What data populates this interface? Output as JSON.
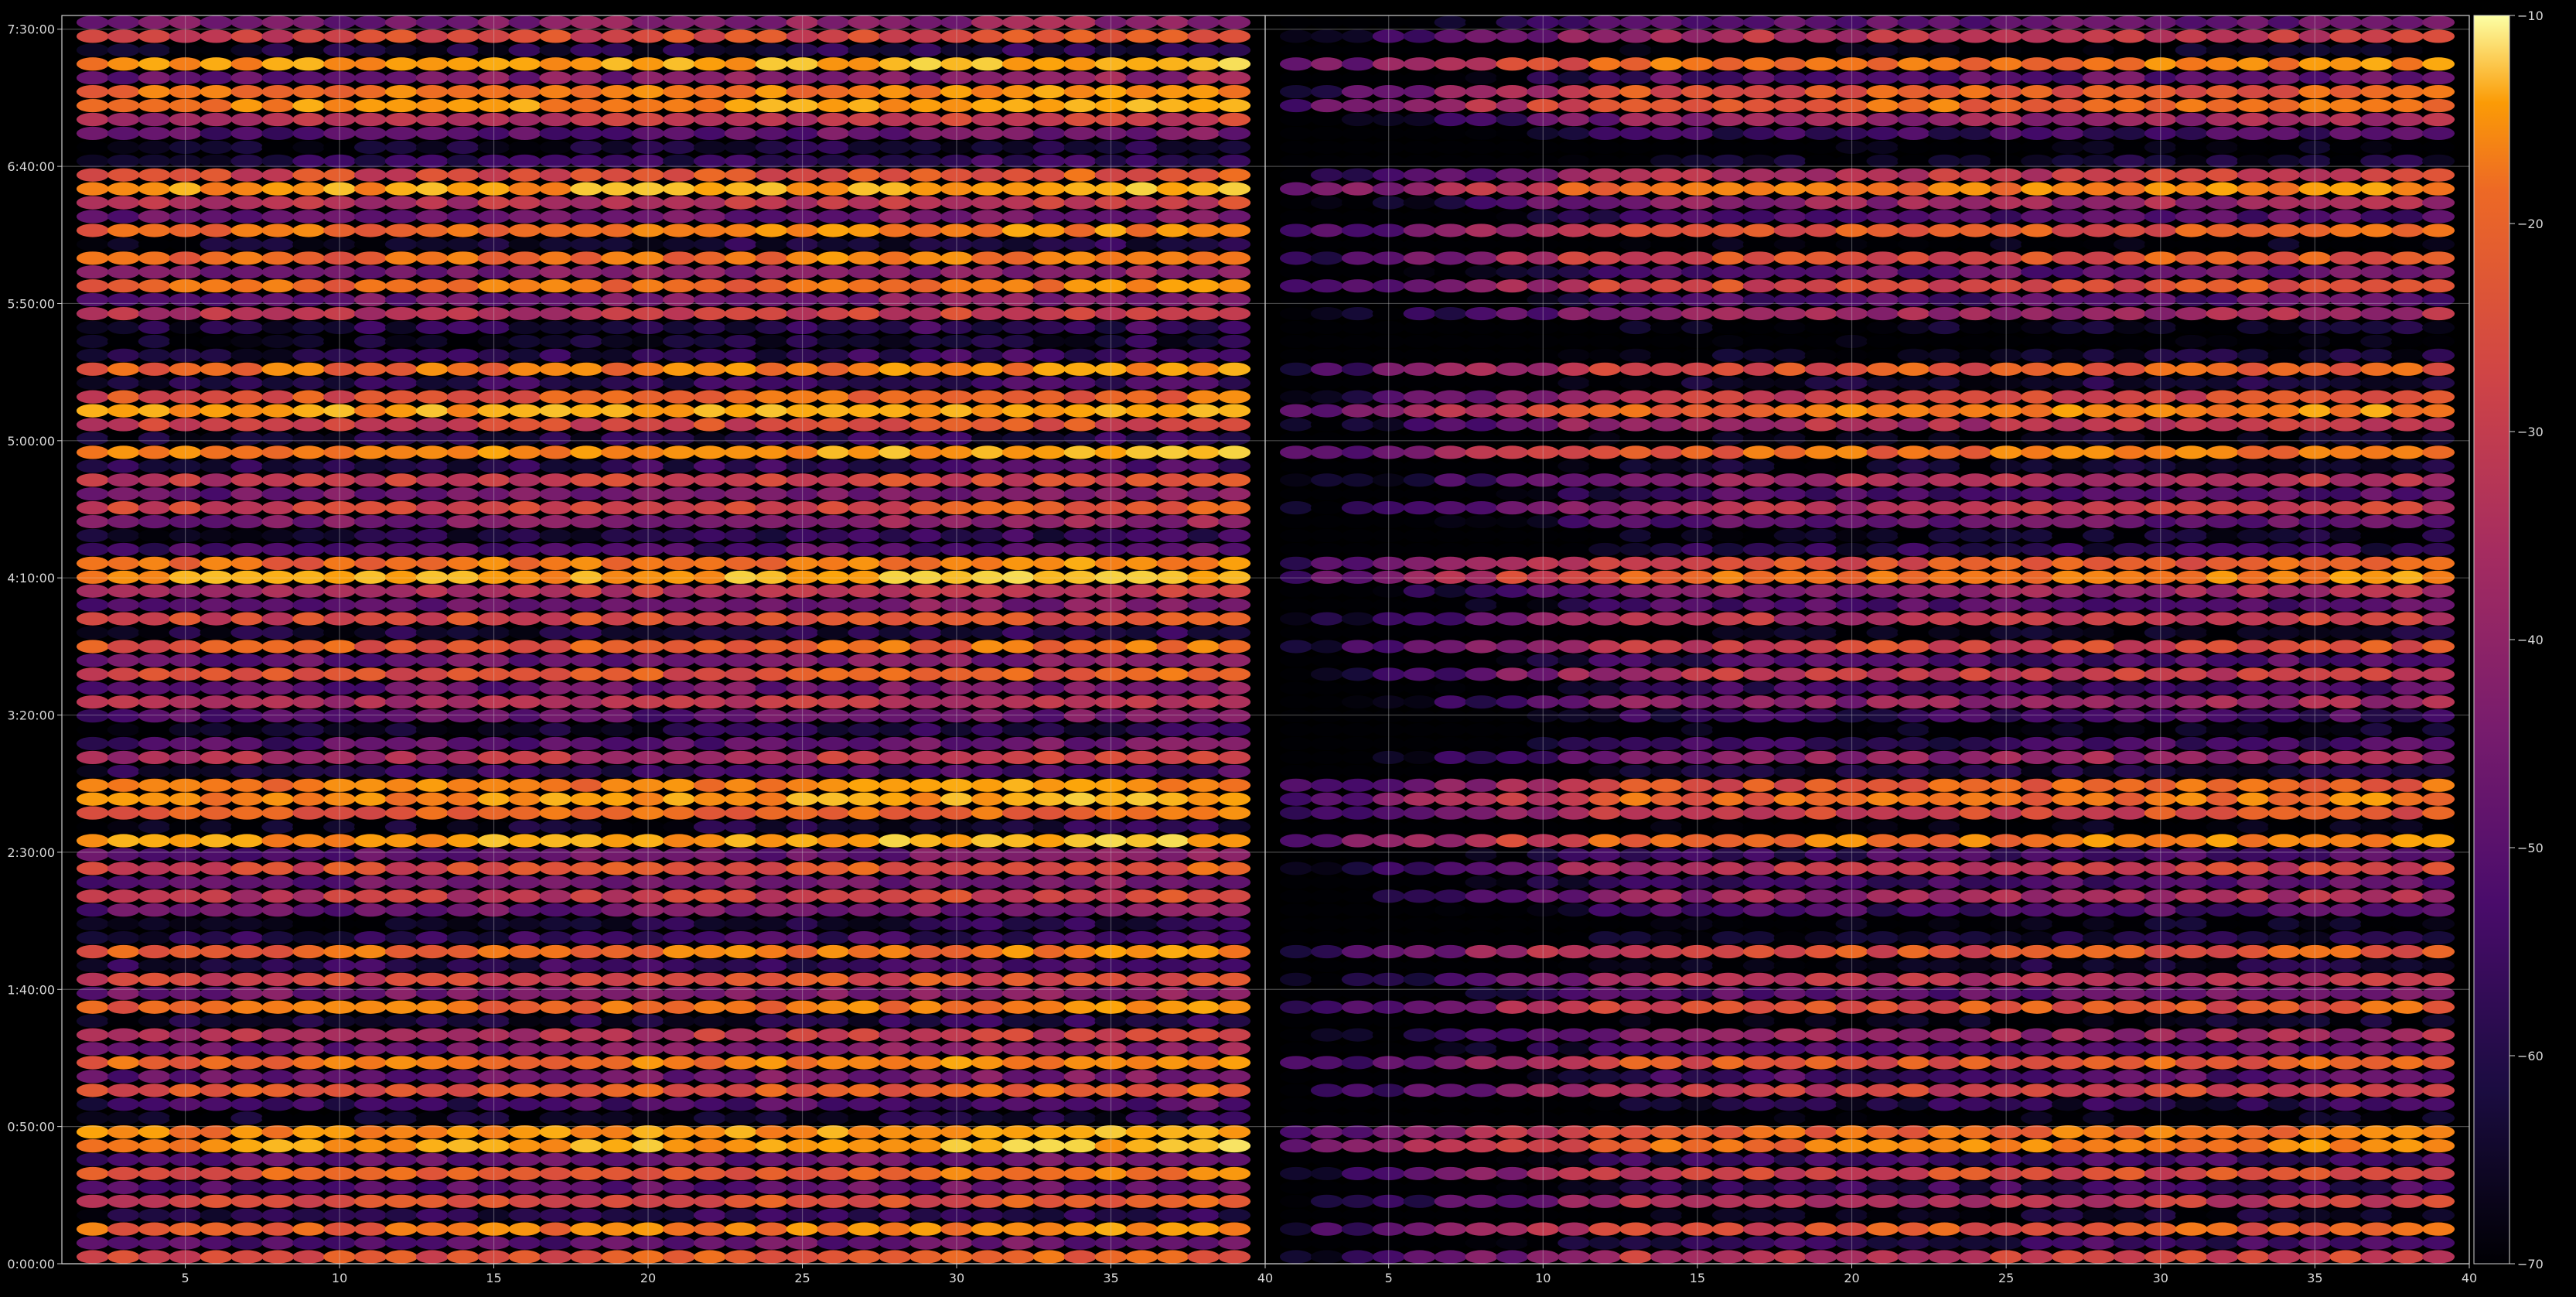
{
  "chart_data": {
    "type": "heatmap",
    "title": "",
    "xlabel": "",
    "ylabel": "",
    "colormap": "inferno",
    "grid": true,
    "panels": [
      {
        "name": "",
        "x_range": [
          1.5,
          39.5
        ]
      },
      {
        "name": "",
        "x_range": [
          1.5,
          39.5
        ]
      }
    ],
    "xlim": [
      1,
      40
    ],
    "x_ticks": [
      5,
      10,
      15,
      20,
      25,
      30,
      35,
      40
    ],
    "x_tick_labels": [
      "5",
      "10",
      "15",
      "20",
      "25",
      "30",
      "35",
      "40"
    ],
    "ylim_seconds": [
      0,
      27300
    ],
    "y_ticks_seconds": [
      0,
      3000,
      6000,
      9000,
      12000,
      15000,
      18000,
      21000,
      24000,
      27000
    ],
    "y_tick_labels": [
      "0:00:00",
      "0:50:00",
      "1:40:00",
      "2:30:00",
      "3:20:00",
      "4:10:00",
      "5:00:00",
      "5:50:00",
      "6:40:00",
      "7:30:00"
    ],
    "colorbar": {
      "range": [
        -70,
        -10
      ],
      "ticks": [
        -10,
        -20,
        -30,
        -40,
        -50,
        -60,
        -70
      ],
      "tick_labels": [
        "−10",
        "−20",
        "−30",
        "−40",
        "−50",
        "−60",
        "−70"
      ]
    },
    "approx_value_range": [
      -70,
      -12
    ],
    "notes": "Dense per-time per-index cell values are not readable individually; overall left panel brighter (roughly -25 to -45) than right panel which is darker at indices 2-12."
  }
}
